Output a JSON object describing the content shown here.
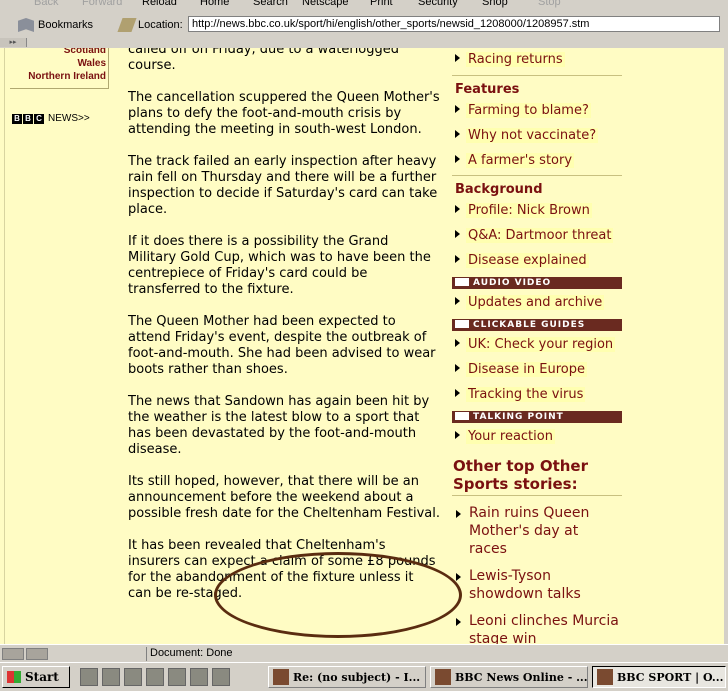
{
  "browser": {
    "menu": [
      "Back",
      "Forward",
      "Reload",
      "Home",
      "Search",
      "Netscape",
      "Print",
      "Security",
      "Shop",
      "Stop"
    ],
    "bookmarks_label": "Bookmarks",
    "location_label": "Location:",
    "url": "http://news.bbc.co.uk/sport/hi/english/other_sports/newsid_1208000/1208957.stm",
    "status": "Document: Done"
  },
  "left": {
    "regions": [
      "Scotland",
      "Wales",
      "Northern Ireland"
    ],
    "bbc_letters": [
      "B",
      "B",
      "C"
    ],
    "news_link": "NEWS>>"
  },
  "article": {
    "paragraphs": [
      "called off on Friday, due to a waterlogged course.",
      "The cancellation scuppered the Queen Mother's plans to defy the foot-and-mouth crisis by attending the meeting in south-west London.",
      "The track failed an early inspection after heavy rain fell on Thursday and there will be a further inspection to decide if Saturday's card can take place.",
      "If it does there is a possibility the Grand Military Gold Cup, which was to have been the centrepiece of Friday's card could be transferred to the fixture.",
      "The Queen Mother had been expected to attend Friday's event, despite the outbreak of foot-and-mouth. She had been advised to wear boots rather than shoes.",
      "The news that Sandown has again been hit by the weather is the latest blow to a sport that has been devastated by the foot-and-mouth disease.",
      "Its still hoped, however, that there will be an announcement before the weekend about a possible fresh date for the Cheltenham Festival.",
      "It has been revealed that Cheltenham's insurers can expect a claim of some £8 pounds for the abandonment of the fixture unless it can be re-staged."
    ]
  },
  "sidebar": {
    "top_item": "Racing returns",
    "features_heading": "Features",
    "features": [
      "Farming to blame?",
      "Why not vaccinate?",
      "A farmer's story"
    ],
    "background_heading": "Background",
    "background": [
      "Profile: Nick Brown",
      "Q&A: Dartmoor threat",
      "Disease explained"
    ],
    "audio_band": "AUDIO VIDEO",
    "audio": [
      "Updates and archive"
    ],
    "guides_band": "CLICKABLE GUIDES",
    "guides": [
      "UK: Check your region",
      "Disease in Europe",
      "Tracking the virus"
    ],
    "talking_band": "TALKING POINT",
    "talking": [
      "Your reaction"
    ],
    "other_title": "Other top Other Sports stories:",
    "other_stories": [
      "Rain ruins Queen Mother's day at races",
      "Lewis-Tyson showdown talks",
      "Leoni clinches Murcia stage win"
    ]
  },
  "taskbar": {
    "start": "Start",
    "tasks": [
      "Re: (no subject) - I...",
      "BBC News Online - ...",
      "BBC SPORT | O..."
    ]
  }
}
